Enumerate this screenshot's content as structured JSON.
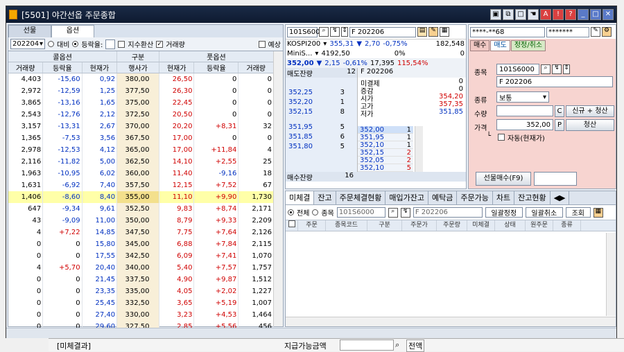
{
  "title": "[5501] 야간선옵 주문종합",
  "left_tabs": [
    "선물",
    "옵션"
  ],
  "left_ctrl": {
    "month": "202204",
    "radio1": "대비",
    "radio2": "등락율:",
    "chk1": "지수환산",
    "chk2": "거래량",
    "chk3": "예상"
  },
  "group_headers": {
    "call": "콜옵션",
    "mid": "구분",
    "put": "풋옵션"
  },
  "col_headers": [
    "거래량",
    "등락율",
    "현재가",
    "행사가",
    "현재가",
    "등락율",
    "거래량"
  ],
  "rows": [
    [
      "4,403",
      "-15,60",
      "0,92",
      "380,00",
      "26,50",
      "0",
      "0"
    ],
    [
      "2,972",
      "-12,59",
      "1,25",
      "377,50",
      "26,30",
      "0",
      "0"
    ],
    [
      "3,865",
      "-13,16",
      "1,65",
      "375,00",
      "22,45",
      "0",
      "0"
    ],
    [
      "2,543",
      "-12,76",
      "2,12",
      "372,50",
      "20,50",
      "0",
      "0"
    ],
    [
      "3,157",
      "-13,31",
      "2,67",
      "370,00",
      "20,20",
      "+8,31",
      "32"
    ],
    [
      "1,365",
      "-7,53",
      "3,56",
      "367,50",
      "17,00",
      "0",
      "0"
    ],
    [
      "2,978",
      "-12,53",
      "4,12",
      "365,00",
      "17,00",
      "+11,84",
      "4"
    ],
    [
      "2,116",
      "-11,82",
      "5,00",
      "362,50",
      "14,10",
      "+2,55",
      "25"
    ],
    [
      "1,963",
      "-10,95",
      "6,02",
      "360,00",
      "11,40",
      "-9,16",
      "18"
    ],
    [
      "1,631",
      "-6,92",
      "7,40",
      "357,50",
      "12,15",
      "+7,52",
      "67"
    ],
    [
      "1,406",
      "-8,60",
      "8,40",
      "355,00",
      "11,10",
      "+9,90",
      "1,730"
    ],
    [
      "647",
      "-9,34",
      "9,61",
      "352,50",
      "9,83",
      "+8,74",
      "2,171"
    ],
    [
      "43",
      "-9,09",
      "11,00",
      "350,00",
      "8,79",
      "+9,33",
      "2,209"
    ],
    [
      "4",
      "+7,22",
      "14,85",
      "347,50",
      "7,75",
      "+7,64",
      "2,126"
    ],
    [
      "0",
      "0",
      "15,80",
      "345,00",
      "6,88",
      "+7,84",
      "2,115"
    ],
    [
      "0",
      "0",
      "17,55",
      "342,50",
      "6,09",
      "+7,41",
      "1,070"
    ],
    [
      "4",
      "+5,70",
      "20,40",
      "340,00",
      "5,40",
      "+7,57",
      "1,757"
    ],
    [
      "0",
      "0",
      "21,45",
      "337,50",
      "4,90",
      "+9,87",
      "1,512"
    ],
    [
      "0",
      "0",
      "23,35",
      "335,00",
      "4,05",
      "+2,02",
      "1,227"
    ],
    [
      "0",
      "0",
      "25,45",
      "332,50",
      "3,65",
      "+5,19",
      "1,007"
    ],
    [
      "0",
      "0",
      "27,40",
      "330,00",
      "3,23",
      "+4,53",
      "1,464"
    ],
    [
      "0",
      "0",
      "29,60",
      "327,50",
      "2,85",
      "+5,56",
      "456"
    ]
  ],
  "mid": {
    "code": "101S600",
    "name": "F 202206",
    "idx1": "KOSPI200",
    "idx1_val": "355,31",
    "idx1_chg": "2,70",
    "idx1_pct": "-0,75%",
    "idx1_vol": "182,548",
    "idx2": "MiniS...",
    "idx2_val": "4192,50",
    "idx2_pct": "0%",
    "idx2_vol": "0",
    "fut_price": "352,00",
    "fut_chg": "2,15",
    "fut_pct": "-0,61%",
    "fut_vol": "17,395",
    "fut_ratio": "115,54%",
    "ask_total_label": "매도잔량",
    "ask_total": "12",
    "bid_total_label": "매수잔량",
    "bid_total": "16",
    "info_title": "F 202206",
    "info": [
      [
        "미결제",
        "0"
      ],
      [
        "증감",
        "0"
      ],
      [
        "시가",
        "354,20"
      ],
      [
        "고가",
        "357,35"
      ],
      [
        "저가",
        "351,85"
      ]
    ],
    "asks": [
      [
        "352,25",
        "3"
      ],
      [
        "352,20",
        "1"
      ],
      [
        "352,15",
        "8"
      ]
    ],
    "bids_left": [
      [
        "351,95",
        "5"
      ],
      [
        "351,85",
        "6"
      ],
      [
        "351,80",
        "5"
      ]
    ],
    "book": [
      [
        "352,00",
        "1"
      ],
      [
        "351,95",
        "1"
      ],
      [
        "352,10",
        "1"
      ],
      [
        "352,15",
        "2"
      ],
      [
        "352,05",
        "2"
      ],
      [
        "352,10",
        "5"
      ]
    ]
  },
  "right": {
    "account": "****-**68",
    "password": "*******",
    "tabs": [
      "매수",
      "매도",
      "정정/취소"
    ],
    "label_code": "종목",
    "code": "101S6000",
    "name": "F 202206",
    "label_type": "종류",
    "type": "보통",
    "label_qty": "수량",
    "qty_c": "C",
    "new_clear": "신규 + 청산",
    "label_price": "가격",
    "price": "352,00",
    "price_p": "P",
    "clear": "청산",
    "auto": "자동(현재가)",
    "buy_btn": "선물매수(F9)"
  },
  "bottom": {
    "tabs": [
      "미체결",
      "잔고",
      "주문체결현황",
      "매입가잔고",
      "예탁금",
      "주문가능",
      "차트",
      "잔고현황"
    ],
    "r_all": "전체",
    "r_code": "종목",
    "code": "101S6000",
    "name": "F 202206",
    "btn1": "일괄정정",
    "btn2": "일괄취소",
    "btn3": "조회",
    "headers": [
      "주문",
      "종목코드",
      "구분",
      "주문가",
      "주문량",
      "미체결",
      "상태",
      "원주문",
      "종류"
    ]
  },
  "background": {
    "left": "[미체결과]",
    "mid": "지급가능금액",
    "right": "전액"
  }
}
